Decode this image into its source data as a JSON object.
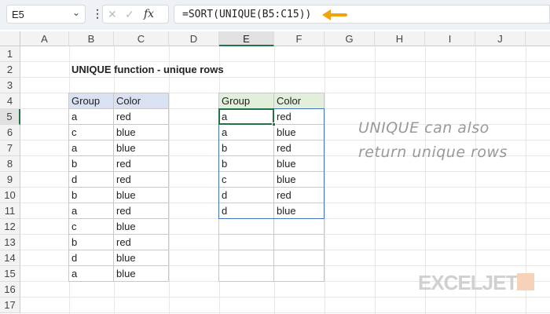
{
  "name_box": "E5",
  "formula": "=SORT(UNIQUE(B5:C15))",
  "columns": [
    "A",
    "B",
    "C",
    "D",
    "E",
    "F",
    "G",
    "H",
    "I",
    "J"
  ],
  "rows": [
    "1",
    "2",
    "3",
    "4",
    "5",
    "6",
    "7",
    "8",
    "9",
    "10",
    "11",
    "12",
    "13",
    "14",
    "15",
    "16",
    "17"
  ],
  "selected_col": "E",
  "selected_row": "5",
  "title": "UNIQUE function - unique rows",
  "source": {
    "headers": [
      "Group",
      "Color"
    ],
    "rows": [
      [
        "a",
        "red"
      ],
      [
        "c",
        "blue"
      ],
      [
        "a",
        "blue"
      ],
      [
        "b",
        "red"
      ],
      [
        "d",
        "red"
      ],
      [
        "b",
        "blue"
      ],
      [
        "a",
        "red"
      ],
      [
        "c",
        "blue"
      ],
      [
        "b",
        "red"
      ],
      [
        "d",
        "blue"
      ],
      [
        "a",
        "blue"
      ]
    ]
  },
  "result": {
    "headers": [
      "Group",
      "Color"
    ],
    "rows": [
      [
        "a",
        "red"
      ],
      [
        "a",
        "blue"
      ],
      [
        "b",
        "red"
      ],
      [
        "b",
        "blue"
      ],
      [
        "c",
        "blue"
      ],
      [
        "d",
        "red"
      ],
      [
        "d",
        "blue"
      ],
      [
        "",
        ""
      ],
      [
        "",
        ""
      ],
      [
        "",
        ""
      ],
      [
        "",
        ""
      ]
    ]
  },
  "note": [
    "UNIQUE can also",
    "return unique rows"
  ],
  "logo": "EXCELJET",
  "colors": {
    "source_header": "#d9e1f2",
    "result_header": "#e2efda",
    "spill_border": "#4472c4",
    "selection": "#217346",
    "arrow": "#f0a30a"
  }
}
